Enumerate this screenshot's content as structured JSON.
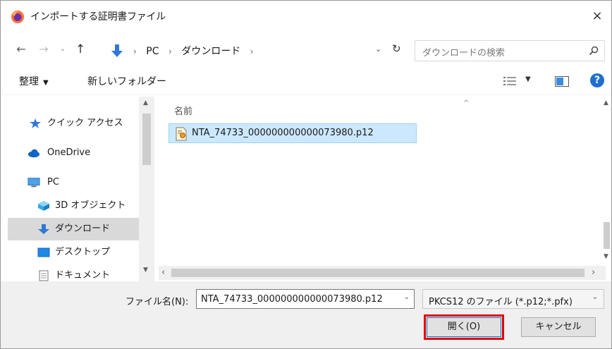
{
  "window": {
    "title": "インポートする証明書ファイル",
    "close_glyph": "×"
  },
  "nav": {
    "back_glyph": "←",
    "forward_glyph": "→",
    "recent_glyph": "⌄",
    "up_glyph": "↑",
    "breadcrumbs": [
      "PC",
      "ダウンロード"
    ],
    "crumb_sep": "›",
    "dropdown_glyph": "⌄",
    "refresh_glyph": "↻"
  },
  "search": {
    "placeholder": "ダウンロードの検索"
  },
  "toolbar": {
    "organize_label": "整理",
    "organize_caret": "▼",
    "new_folder_label": "新しいフォルダー",
    "view_caret": "▼",
    "help_label": "?"
  },
  "sidebar": {
    "items": [
      {
        "label": "クイック アクセス",
        "icon": "star-icon"
      },
      {
        "label": "OneDrive",
        "icon": "cloud-icon"
      },
      {
        "label": "PC",
        "icon": "computer-icon"
      },
      {
        "label": "3D オブジェクト",
        "icon": "cube-icon"
      },
      {
        "label": "ダウンロード",
        "icon": "download-icon",
        "selected": true
      },
      {
        "label": "デスクトップ",
        "icon": "desktop-icon"
      },
      {
        "label": "ドキュメント",
        "icon": "document-icon"
      }
    ]
  },
  "filelist": {
    "column_name": "名前",
    "sort_glyph": "^",
    "files": [
      {
        "name": "NTA_74733_000000000000073980.p12",
        "icon": "certificate-file-icon",
        "selected": true
      }
    ]
  },
  "footer": {
    "filename_label": "ファイル名(N):",
    "filename_value": "NTA_74733_000000000000073980.p12",
    "filetype_value": "PKCS12 のファイル (*.p12;*.pfx)",
    "open_label": "開く(O)",
    "cancel_label": "キャンセル"
  },
  "colors": {
    "accent": "#0078d7",
    "selection": "#cce8ff",
    "highlight_border": "#e30000",
    "help_blue": "#1f6fd1"
  }
}
